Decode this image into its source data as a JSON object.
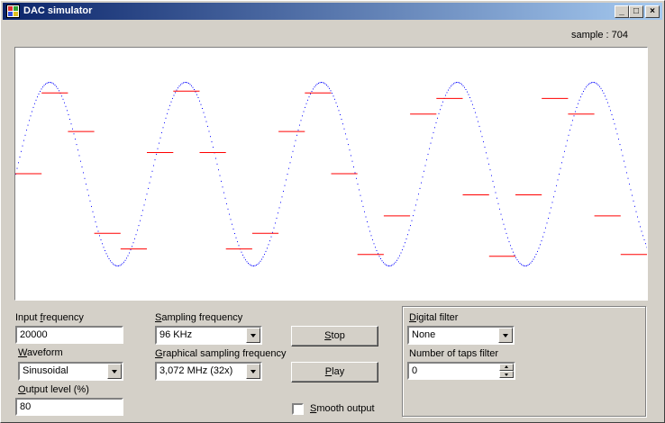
{
  "window": {
    "title": "DAC simulator",
    "minimize": "_",
    "maximize": "□",
    "close": "×"
  },
  "status": {
    "sample_label": "sample : 704"
  },
  "waveform_plot": {
    "wave_color": "#0000ff",
    "steps_color": "#ff0000",
    "cycles": 4.65,
    "start_phase": 0.0,
    "step_count": 24,
    "step_levels": [
      0.0,
      0.88,
      0.46,
      -0.65,
      -0.82,
      0.23,
      0.9,
      0.23,
      -0.82,
      -0.65,
      0.46,
      0.88,
      0.0,
      -0.88,
      -0.46,
      0.65,
      0.82,
      -0.23,
      -0.9,
      -0.23,
      0.82,
      0.65,
      -0.46,
      -0.88
    ]
  },
  "controls": {
    "input_frequency": {
      "label_pre": "Input ",
      "label_key": "f",
      "label_post": "requency",
      "value": "20000"
    },
    "waveform": {
      "label_pre": "",
      "label_key": "W",
      "label_post": "aveform",
      "value": "Sinusoidal"
    },
    "output_level": {
      "label_pre": "",
      "label_key": "O",
      "label_post": "utput level (%)",
      "value": "80"
    },
    "sampling_frequency": {
      "label_pre": "",
      "label_key": "S",
      "label_post": "ampling frequency",
      "value": "96 KHz"
    },
    "graphical_sampling": {
      "label_pre": "",
      "label_key": "G",
      "label_post": "raphical sampling frequency",
      "value": "3,072 MHz (32x)"
    },
    "stop_button": {
      "key": "S",
      "rest": "top"
    },
    "play_button": {
      "key": "P",
      "rest": "lay"
    },
    "smooth_output": {
      "key": "S",
      "rest": "mooth output"
    },
    "digital_filter": {
      "label_pre": "",
      "label_key": "D",
      "label_post": "igital filter",
      "value": "None"
    },
    "taps_filter": {
      "label": "Number of taps filter",
      "value": "0"
    }
  }
}
